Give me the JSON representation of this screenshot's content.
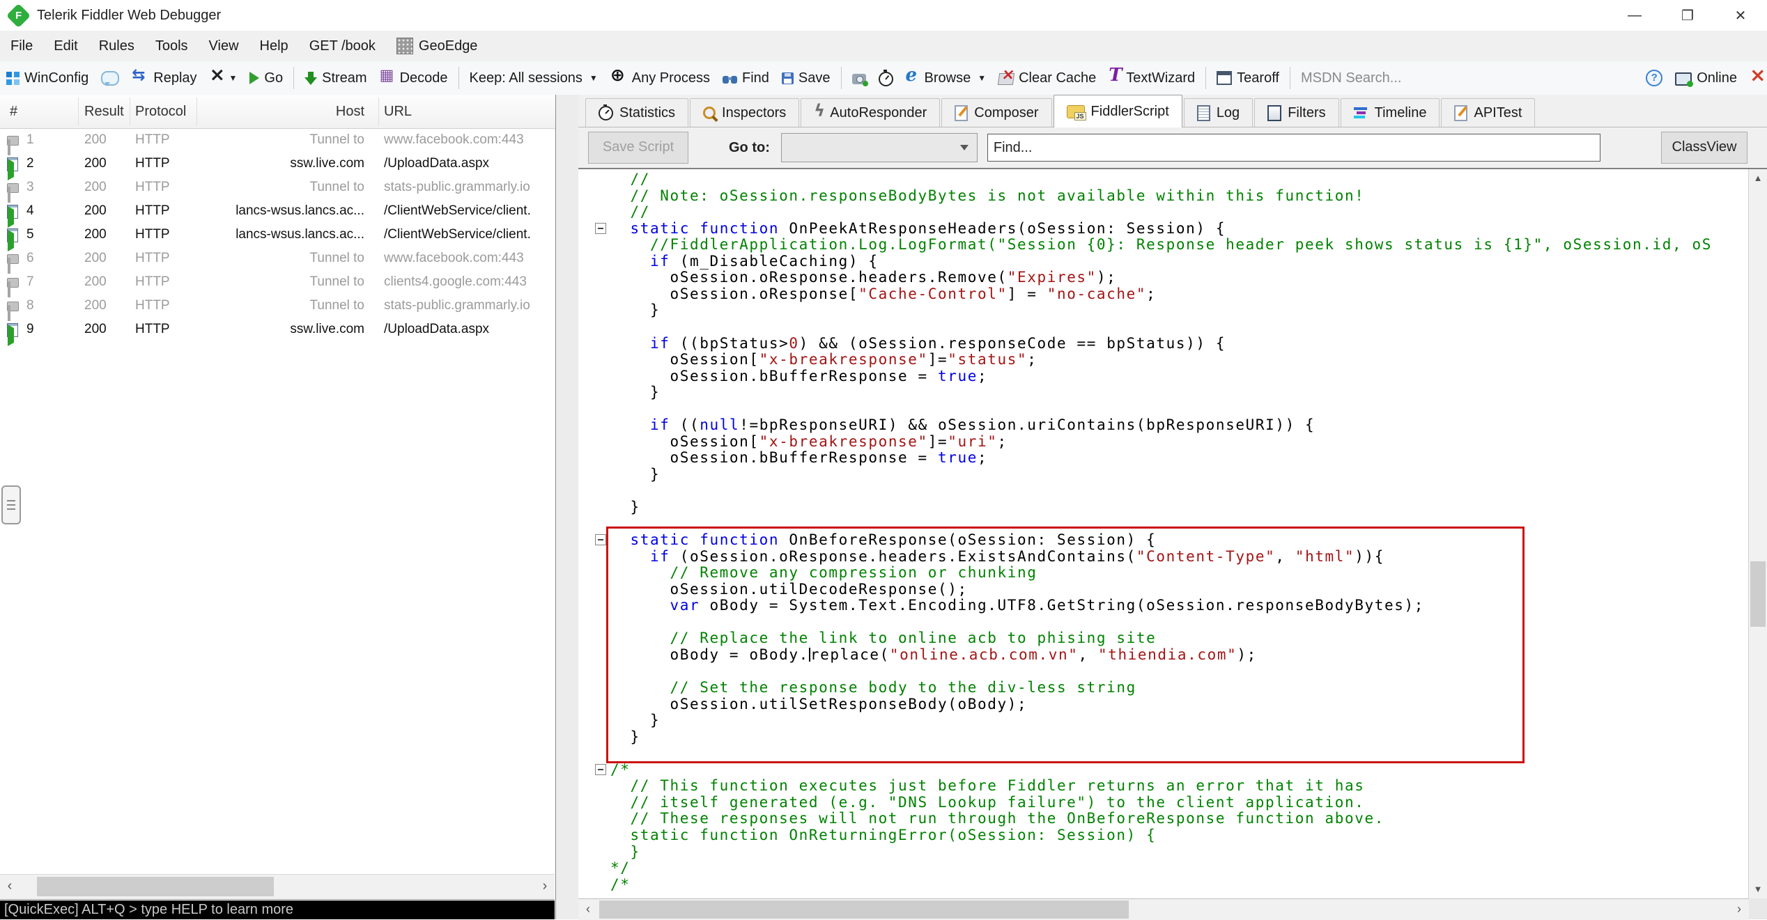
{
  "window": {
    "title": "Telerik Fiddler Web Debugger",
    "minimize": "—",
    "restore": "❐",
    "close": "✕"
  },
  "menu": {
    "items": [
      {
        "label": "File"
      },
      {
        "label": "Edit"
      },
      {
        "label": "Rules"
      },
      {
        "label": "Tools"
      },
      {
        "label": "View"
      },
      {
        "label": "Help"
      },
      {
        "label": "GET /book"
      },
      {
        "label": "GeoEdge",
        "icon": "geoedge"
      }
    ]
  },
  "toolbar": {
    "items": [
      {
        "name": "winconfig",
        "icon": "win",
        "label": "WinConfig"
      },
      {
        "name": "comment",
        "icon": "bubble",
        "label": ""
      },
      {
        "name": "replay",
        "icon": "replay",
        "label": "Replay"
      },
      {
        "name": "remove-sessions",
        "icon": "xblack",
        "label": "",
        "caret": true
      },
      {
        "name": "go",
        "icon": "play",
        "label": "Go"
      },
      {
        "sep": true
      },
      {
        "name": "stream",
        "icon": "stream",
        "label": "Stream"
      },
      {
        "name": "decode",
        "icon": "decode",
        "label": "Decode"
      },
      {
        "sep": true
      },
      {
        "name": "keep-sessions",
        "label": "Keep: All sessions",
        "caret": true
      },
      {
        "name": "any-process",
        "icon": "target",
        "label": "Any Process"
      },
      {
        "name": "find",
        "icon": "binoculars",
        "label": "Find"
      },
      {
        "name": "save",
        "icon": "floppy",
        "label": "Save"
      },
      {
        "sep": true
      },
      {
        "name": "screenshot",
        "icon": "camera",
        "label": ""
      },
      {
        "name": "timer",
        "icon": "stopwatch",
        "label": ""
      },
      {
        "name": "browse",
        "icon": "ie",
        "label": "Browse",
        "caret": true
      },
      {
        "name": "clear-cache",
        "icon": "clearcache",
        "label": "Clear Cache"
      },
      {
        "name": "textwizard",
        "icon": "tletter",
        "label": "TextWizard"
      },
      {
        "sep": true
      },
      {
        "name": "tearoff",
        "icon": "tearoff",
        "label": "Tearoff"
      },
      {
        "sep": true
      },
      {
        "name": "msdn-search",
        "label": "MSDN Search...",
        "muted": true
      },
      {
        "name": "help",
        "icon": "helpq",
        "label": "",
        "right": true
      },
      {
        "name": "online",
        "icon": "online",
        "label": "Online"
      },
      {
        "name": "close-x",
        "icon": "xred",
        "label": ""
      }
    ]
  },
  "sessions": {
    "columns": [
      "#",
      "Result",
      "Protocol",
      "Host",
      "URL"
    ],
    "rows": [
      {
        "num": "1",
        "icon": "lock",
        "result": "200",
        "protocol": "HTTP",
        "host": "Tunnel to",
        "url": "www.facebook.com:443",
        "muted": true
      },
      {
        "num": "2",
        "icon": "updoc",
        "result": "200",
        "protocol": "HTTP",
        "host": "ssw.live.com",
        "url": "/UploadData.aspx",
        "muted": false
      },
      {
        "num": "3",
        "icon": "lock",
        "result": "200",
        "protocol": "HTTP",
        "host": "Tunnel to",
        "url": "stats-public.grammarly.io",
        "muted": true
      },
      {
        "num": "4",
        "icon": "updoc",
        "result": "200",
        "protocol": "HTTP",
        "host": "lancs-wsus.lancs.ac...",
        "url": "/ClientWebService/client.",
        "muted": false
      },
      {
        "num": "5",
        "icon": "updoc",
        "result": "200",
        "protocol": "HTTP",
        "host": "lancs-wsus.lancs.ac...",
        "url": "/ClientWebService/client.",
        "muted": false
      },
      {
        "num": "6",
        "icon": "lock",
        "result": "200",
        "protocol": "HTTP",
        "host": "Tunnel to",
        "url": "www.facebook.com:443",
        "muted": true
      },
      {
        "num": "7",
        "icon": "lock",
        "result": "200",
        "protocol": "HTTP",
        "host": "Tunnel to",
        "url": "clients4.google.com:443",
        "muted": true
      },
      {
        "num": "8",
        "icon": "lock",
        "result": "200",
        "protocol": "HTTP",
        "host": "Tunnel to",
        "url": "stats-public.grammarly.io",
        "muted": true
      },
      {
        "num": "9",
        "icon": "updoc",
        "result": "200",
        "protocol": "HTTP",
        "host": "ssw.live.com",
        "url": "/UploadData.aspx",
        "muted": false
      }
    ]
  },
  "tabs": [
    {
      "label": "Statistics",
      "icon": "clock"
    },
    {
      "label": "Inspectors",
      "icon": "magnifier"
    },
    {
      "label": "AutoResponder",
      "icon": "lightning"
    },
    {
      "label": "Composer",
      "icon": "compose"
    },
    {
      "label": "FiddlerScript",
      "icon": "scroll",
      "active": true
    },
    {
      "label": "Log",
      "icon": "log"
    },
    {
      "label": "Filters",
      "icon": "checkbox"
    },
    {
      "label": "Timeline",
      "icon": "timeline"
    },
    {
      "label": "APITest",
      "icon": "compose"
    }
  ],
  "script_toolbar": {
    "save": "Save Script",
    "goto": "Go to:",
    "find": "Find...",
    "classview": "ClassView"
  },
  "editor": {
    "lines": [
      {
        "s": [
          [
            "  //",
            "c"
          ]
        ]
      },
      {
        "s": [
          [
            "  // Note: oSession.responseBodyBytes is not available within this function!",
            "c"
          ]
        ]
      },
      {
        "s": [
          [
            "  //",
            "c"
          ]
        ]
      },
      {
        "f": true,
        "s": [
          [
            "  ",
            "p"
          ],
          [
            "static function",
            "k"
          ],
          [
            " OnPeekAtResponseHeaders(oSession: Session) {",
            "p"
          ]
        ]
      },
      {
        "s": [
          [
            "    ",
            "p"
          ],
          [
            "//FiddlerApplication.Log.LogFormat(\"Session {0}: Response header peek shows status is {1}\", oSession.id, oS",
            "c"
          ]
        ]
      },
      {
        "s": [
          [
            "    ",
            "p"
          ],
          [
            "if",
            "k"
          ],
          [
            " (m_DisableCaching) {",
            "p"
          ]
        ]
      },
      {
        "s": [
          [
            "      oSession.oResponse.headers.Remove(",
            "p"
          ],
          [
            "\"Expires\"",
            "s"
          ],
          [
            ");",
            "p"
          ]
        ]
      },
      {
        "s": [
          [
            "      oSession.oResponse[",
            "p"
          ],
          [
            "\"Cache-Control\"",
            "s"
          ],
          [
            "] = ",
            "p"
          ],
          [
            "\"no-cache\"",
            "s"
          ],
          [
            ";",
            "p"
          ]
        ]
      },
      {
        "s": [
          [
            "    }",
            "p"
          ]
        ]
      },
      {
        "s": []
      },
      {
        "s": [
          [
            "    ",
            "p"
          ],
          [
            "if",
            "k"
          ],
          [
            " ((bpStatus>",
            "p"
          ],
          [
            "0",
            "s"
          ],
          [
            ") && (oSession.responseCode == bpStatus)) {",
            "p"
          ]
        ]
      },
      {
        "s": [
          [
            "      oSession[",
            "p"
          ],
          [
            "\"x-breakresponse\"",
            "s"
          ],
          [
            "]=",
            "p"
          ],
          [
            "\"status\"",
            "s"
          ],
          [
            ";",
            "p"
          ]
        ]
      },
      {
        "s": [
          [
            "      oSession.bBufferResponse = ",
            "p"
          ],
          [
            "true",
            "k"
          ],
          [
            ";",
            "p"
          ]
        ]
      },
      {
        "s": [
          [
            "    }",
            "p"
          ]
        ]
      },
      {
        "s": []
      },
      {
        "s": [
          [
            "    ",
            "p"
          ],
          [
            "if",
            "k"
          ],
          [
            " ((",
            "p"
          ],
          [
            "null",
            "k"
          ],
          [
            "!=bpResponseURI) && oSession.uriContains(bpResponseURI)) {",
            "p"
          ]
        ]
      },
      {
        "s": [
          [
            "      oSession[",
            "p"
          ],
          [
            "\"x-breakresponse\"",
            "s"
          ],
          [
            "]=",
            "p"
          ],
          [
            "\"uri\"",
            "s"
          ],
          [
            ";",
            "p"
          ]
        ]
      },
      {
        "s": [
          [
            "      oSession.bBufferResponse = ",
            "p"
          ],
          [
            "true",
            "k"
          ],
          [
            ";",
            "p"
          ]
        ]
      },
      {
        "s": [
          [
            "    }",
            "p"
          ]
        ]
      },
      {
        "s": []
      },
      {
        "s": [
          [
            "  }",
            "p"
          ]
        ]
      },
      {
        "s": []
      },
      {
        "f": true,
        "s": [
          [
            "  ",
            "p"
          ],
          [
            "static function",
            "k"
          ],
          [
            " OnBeforeResponse(oSession: Session) {",
            "p"
          ]
        ]
      },
      {
        "s": [
          [
            "    ",
            "p"
          ],
          [
            "if",
            "k"
          ],
          [
            " (oSession.oResponse.headers.ExistsAndContains(",
            "p"
          ],
          [
            "\"Content-Type\"",
            "s"
          ],
          [
            ", ",
            "p"
          ],
          [
            "\"html\"",
            "s"
          ],
          [
            ")){",
            "p"
          ]
        ]
      },
      {
        "s": [
          [
            "      ",
            "p"
          ],
          [
            "// Remove any compression or chunking",
            "c"
          ]
        ]
      },
      {
        "s": [
          [
            "      oSession.utilDecodeResponse();",
            "p"
          ]
        ]
      },
      {
        "s": [
          [
            "      ",
            "p"
          ],
          [
            "var",
            "k"
          ],
          [
            " oBody = System.Text.Encoding.UTF8.GetString(oSession.responseBodyBytes);",
            "p"
          ]
        ]
      },
      {
        "s": []
      },
      {
        "s": [
          [
            "      ",
            "p"
          ],
          [
            "// Replace the link to online acb to phising site",
            "c"
          ]
        ]
      },
      {
        "s": [
          [
            "      oBody = oBody.",
            "p"
          ],
          [
            "",
            "caret"
          ],
          [
            "replace(",
            "p"
          ],
          [
            "\"online.acb.com.vn\"",
            "s"
          ],
          [
            ", ",
            "p"
          ],
          [
            "\"thiendia.com\"",
            "s"
          ],
          [
            ");",
            "p"
          ]
        ]
      },
      {
        "s": []
      },
      {
        "s": [
          [
            "      ",
            "p"
          ],
          [
            "// Set the response body to the div-less string",
            "c"
          ]
        ]
      },
      {
        "s": [
          [
            "      oSession.utilSetResponseBody(oBody);",
            "p"
          ]
        ]
      },
      {
        "s": [
          [
            "    }",
            "p"
          ]
        ]
      },
      {
        "s": [
          [
            "  }",
            "p"
          ]
        ]
      },
      {
        "s": []
      },
      {
        "f": true,
        "s": [
          [
            "/*",
            "c"
          ]
        ]
      },
      {
        "s": [
          [
            "  // This function executes just before Fiddler returns an error that it has",
            "c"
          ]
        ]
      },
      {
        "s": [
          [
            "  // itself generated (e.g. \"DNS Lookup failure\") to the client application.",
            "c"
          ]
        ]
      },
      {
        "s": [
          [
            "  // These responses will not run through the OnBeforeResponse function above.",
            "c"
          ]
        ]
      },
      {
        "s": [
          [
            "  static function OnReturningError(oSession: Session) {",
            "c"
          ]
        ]
      },
      {
        "s": [
          [
            "  }",
            "c"
          ]
        ]
      },
      {
        "s": [
          [
            "*/",
            "c"
          ]
        ]
      },
      {
        "s": [
          [
            "/*",
            "c"
          ]
        ]
      }
    ]
  },
  "statusbar": {
    "quickexec": "[QuickExec] ALT+Q > type HELP to learn more"
  },
  "colors": {
    "keyword": "#0000E6",
    "comment": "#008200",
    "string": "#A21515",
    "highlight_box": "#CC1111",
    "fiddler_green": "#2FAE3E"
  }
}
